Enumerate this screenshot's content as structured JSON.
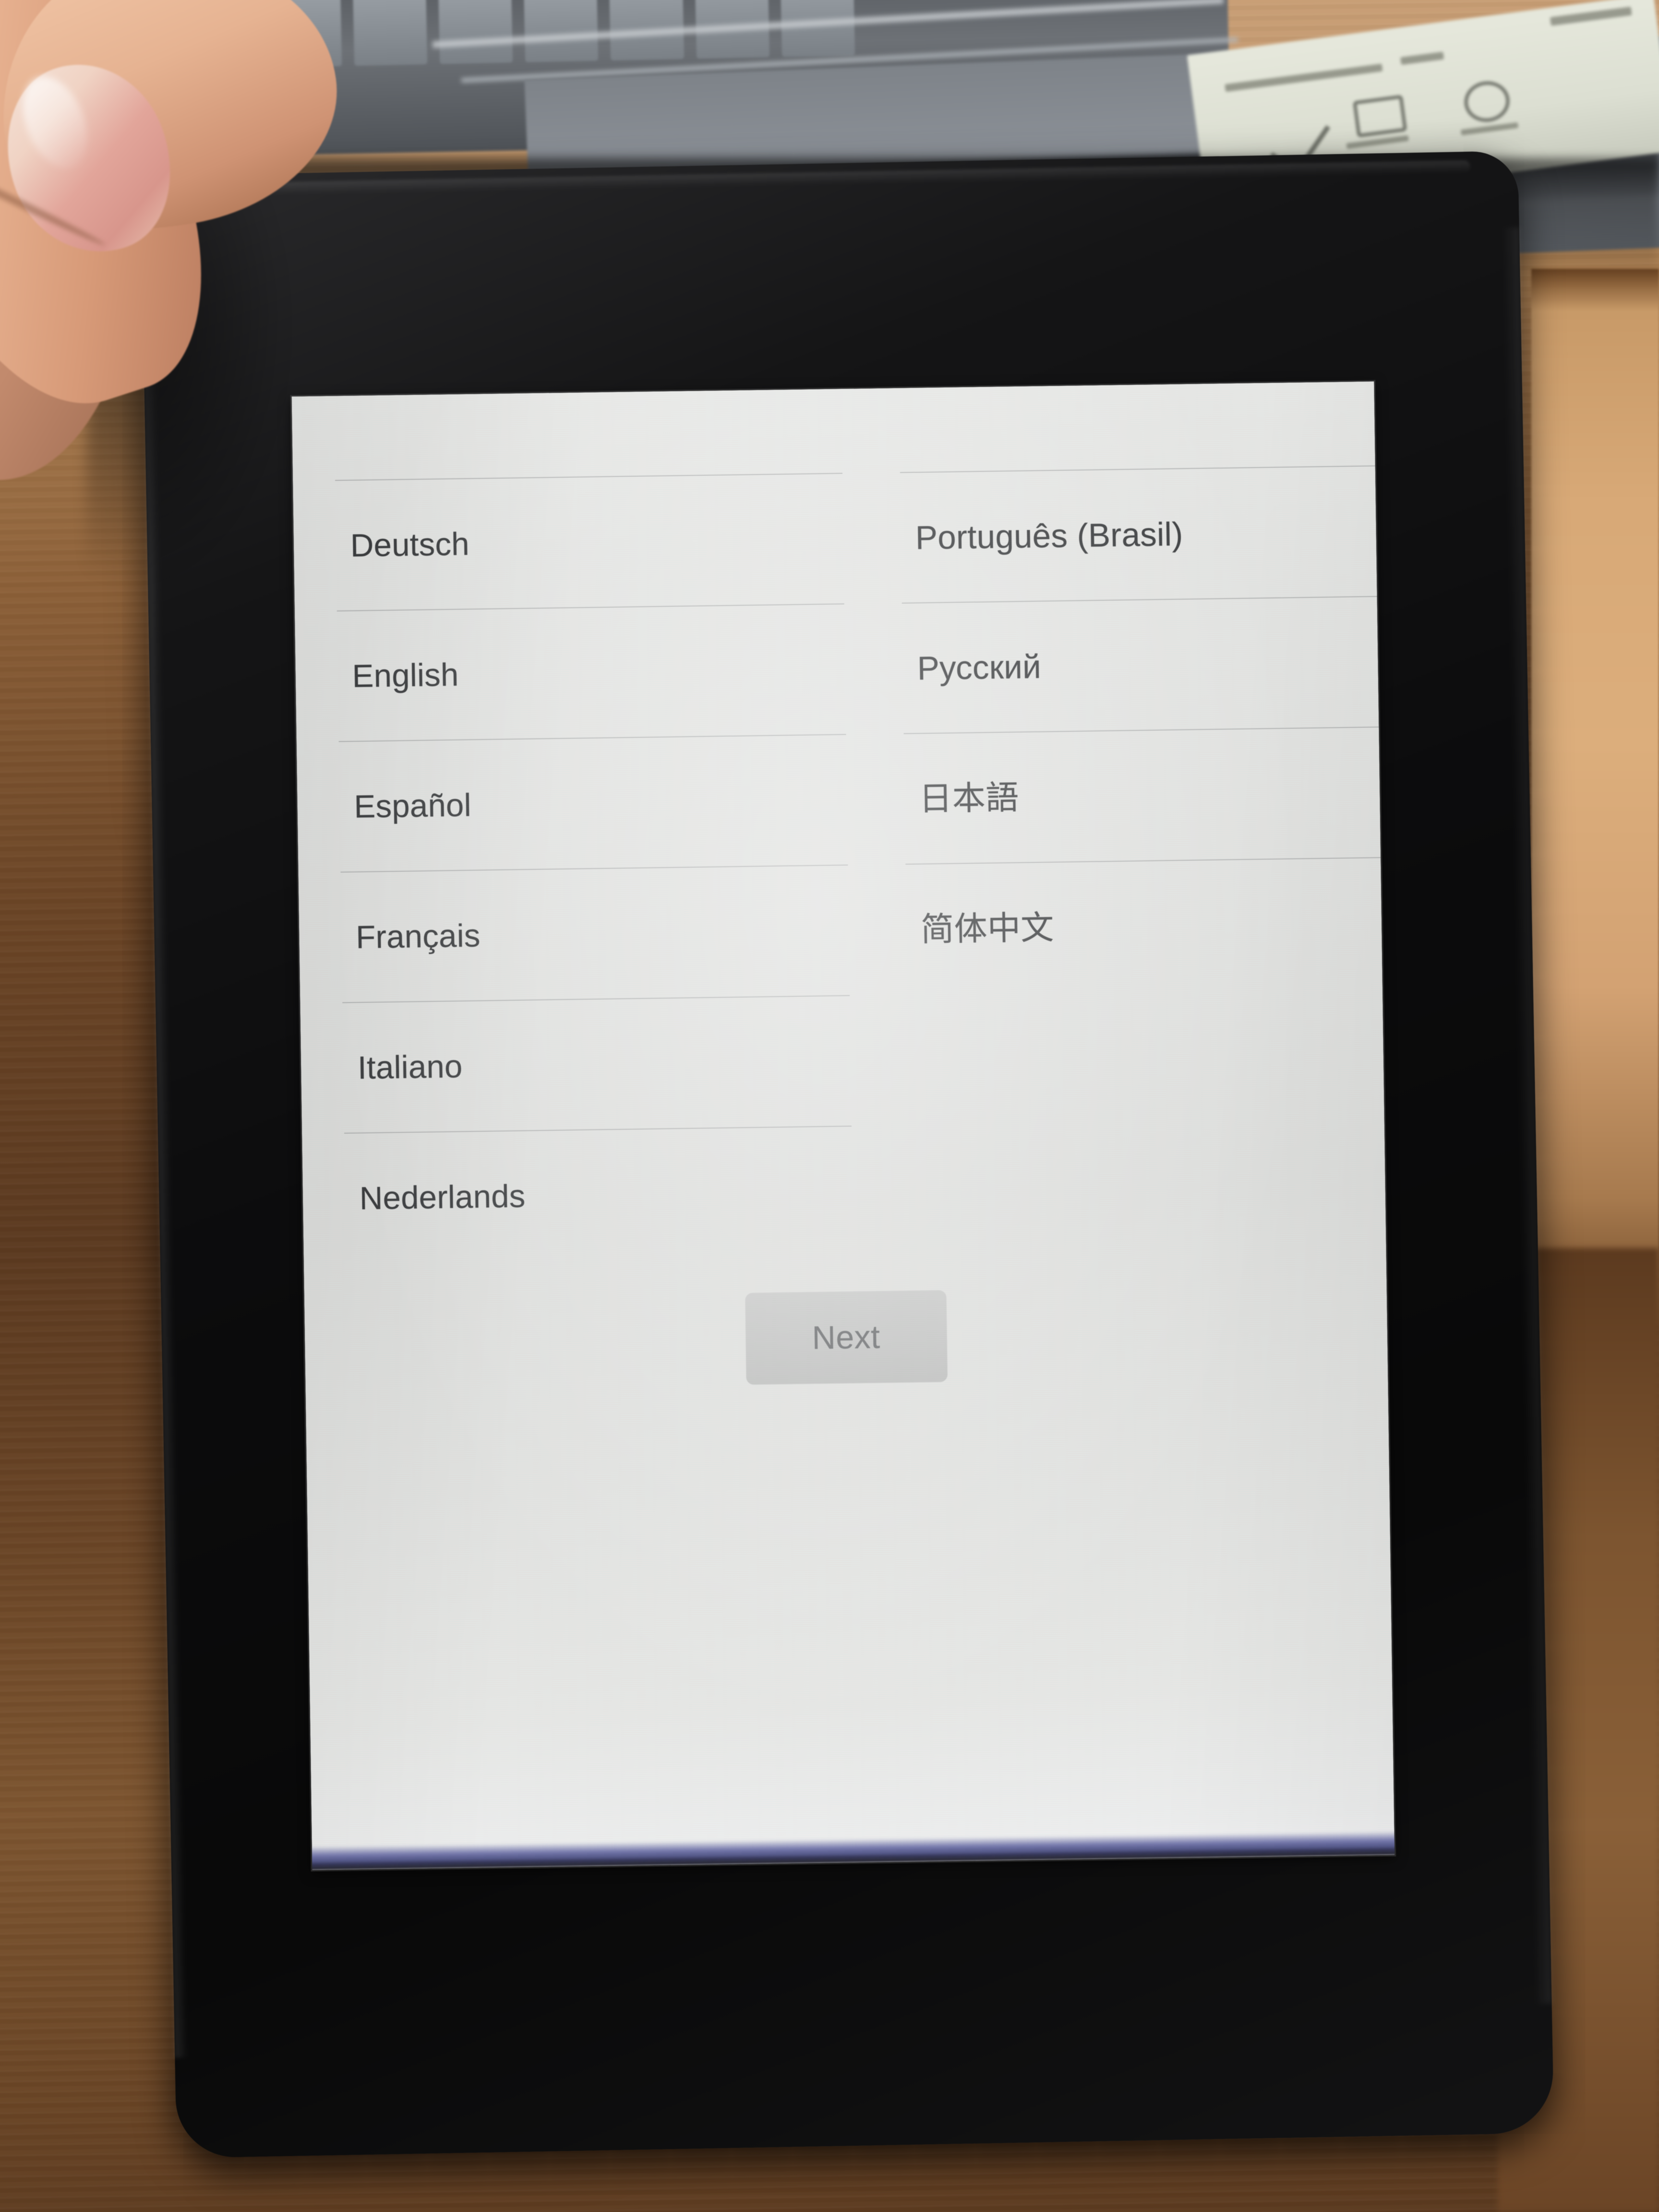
{
  "device": {
    "type": "e-reader",
    "bezel_color": "#0c0c0d",
    "screen_background": "#e1e2e0"
  },
  "screen": {
    "title": "",
    "language_columns": {
      "left": [
        {
          "label": "Deutsch"
        },
        {
          "label": "English"
        },
        {
          "label": "Español"
        },
        {
          "label": "Français"
        },
        {
          "label": "Italiano"
        },
        {
          "label": "Nederlands"
        }
      ],
      "right": [
        {
          "label": "Português (Brasil)"
        },
        {
          "label": "Русский"
        },
        {
          "label": "日本語"
        },
        {
          "label": "简体中文"
        }
      ]
    },
    "next_button": {
      "label": "Next",
      "state": "disabled",
      "fill_color": "#c4c5c4",
      "text_color": "#6f7173"
    }
  },
  "environment": {
    "desk_surface": "wooden desk",
    "desk_color": "#8c6038",
    "laptop_color": "#7e8389",
    "hand": "thumb holding device at top-left"
  }
}
